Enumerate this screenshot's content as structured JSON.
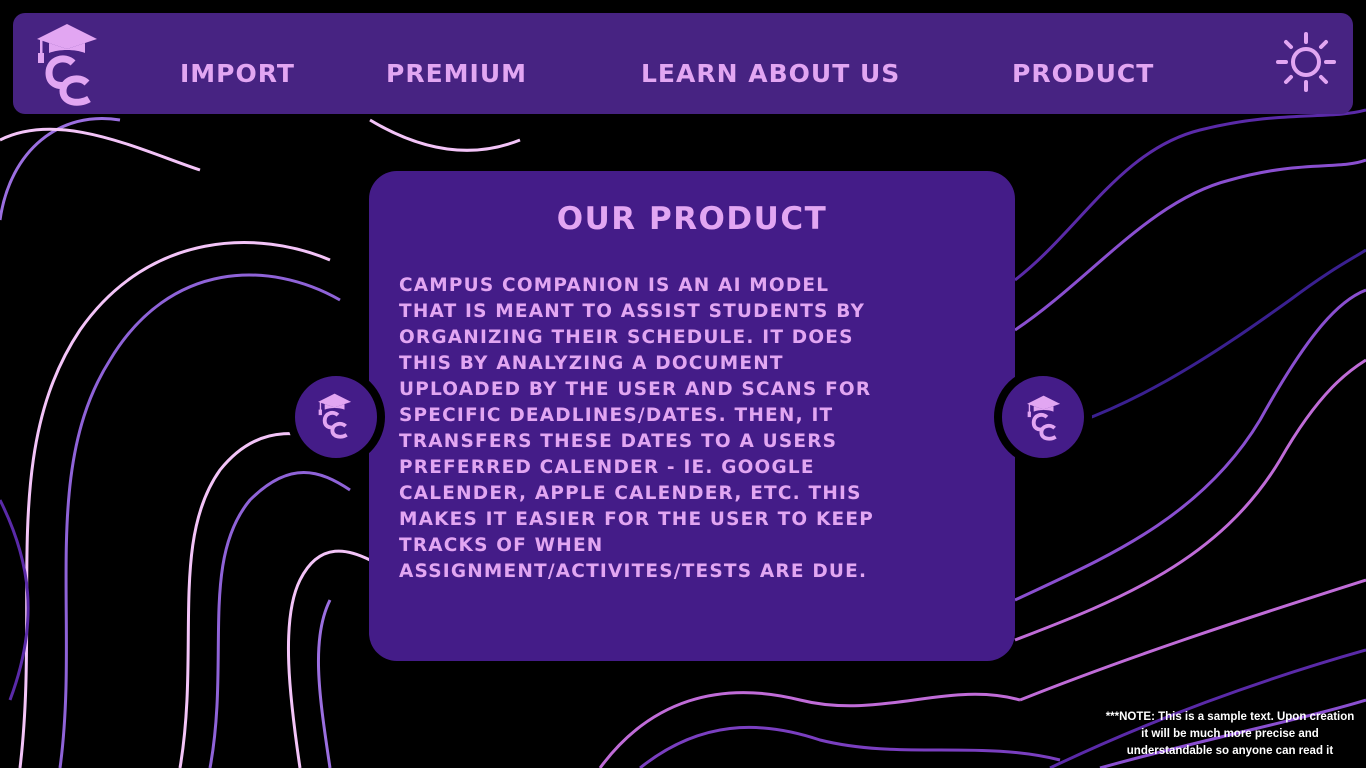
{
  "colors": {
    "nav_bg": "#472382",
    "card_bg": "#441c88",
    "accent_text": "#e2a6f2",
    "background": "#000000"
  },
  "nav": {
    "logo_icon": "campus-companion-cc-graduation-cap-logo",
    "items": [
      {
        "label": "IMPORT"
      },
      {
        "label": "PREMIUM"
      },
      {
        "label": "LEARN ABOUT US"
      },
      {
        "label": "PRODUCT"
      }
    ],
    "theme_icon": "sun-icon"
  },
  "card": {
    "title": "OUR PRODUCT",
    "lines": [
      "CAMPUS COMPANION IS AN AI MODEL",
      "THAT IS MEANT TO ASSIST STUDENTS BY",
      "ORGANIZING THEIR SCHEDULE. IT DOES",
      "THIS BY ANALYZING A DOCUMENT",
      "UPLOADED BY THE USER AND SCANS FOR",
      "SPECIFIC DEADLINES/DATES. THEN, IT",
      "TRANSFERS THESE DATES TO A USERS",
      "PREFERRED CALENDER - IE. GOOGLE",
      "CALENDER, APPLE CALENDER, ETC. THIS",
      "MAKES IT EASIER FOR THE USER TO KEEP",
      "TRACKS OF WHEN",
      "ASSIGNMENT/ACTIVITES/TESTS ARE DUE."
    ]
  },
  "note": {
    "lines": [
      "***NOTE: This is a sample text. Upon creation",
      "it will be much more precise and",
      "understandable so anyone can read it"
    ]
  }
}
